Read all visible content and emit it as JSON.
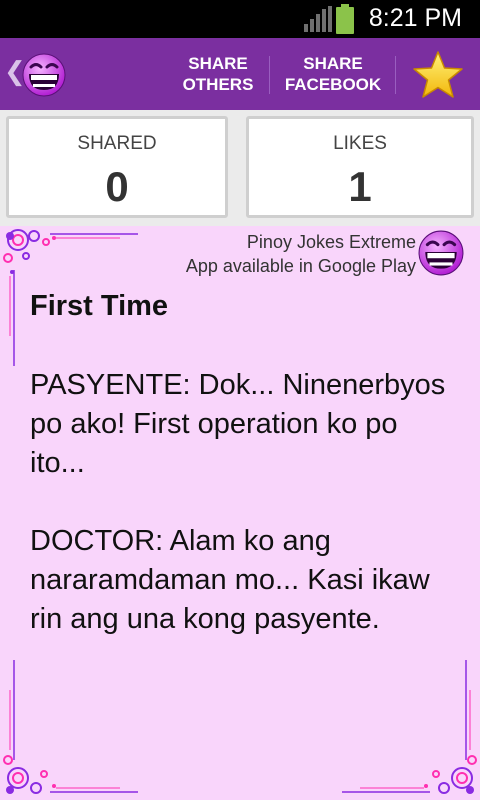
{
  "status_bar": {
    "time": "8:21 PM",
    "icons": [
      "signal-icon",
      "battery-icon"
    ]
  },
  "action_bar": {
    "back_icon": "chevron-left-icon",
    "logo_icon": "laughing-smiley-icon",
    "share_others": [
      "SHARE",
      "OTHERS"
    ],
    "share_facebook": [
      "SHARE",
      "FACEBOOK"
    ],
    "favorite_icon": "star-icon"
  },
  "stats": {
    "shared_label": "SHARED",
    "shared_value": "0",
    "likes_label": "LIKES",
    "likes_value": "1"
  },
  "promo": {
    "line1": "Pinoy Jokes Extreme",
    "line2": "App available in Google Play",
    "icon": "laughing-smiley-icon"
  },
  "joke": {
    "title": "First Time",
    "paragraphs": [
      "PASYENTE: Dok... Ninenerbyos po ako! First operation ko po ito...",
      "DOCTOR: Alam ko ang nararamdaman mo... Kasi ikaw rin ang una kong pasyente."
    ]
  },
  "colors": {
    "action_bar": "#7b2fa0",
    "content_bg": "#f9d5fb",
    "accent_purple": "#8a2be2",
    "accent_pink": "#ff2fb0"
  }
}
